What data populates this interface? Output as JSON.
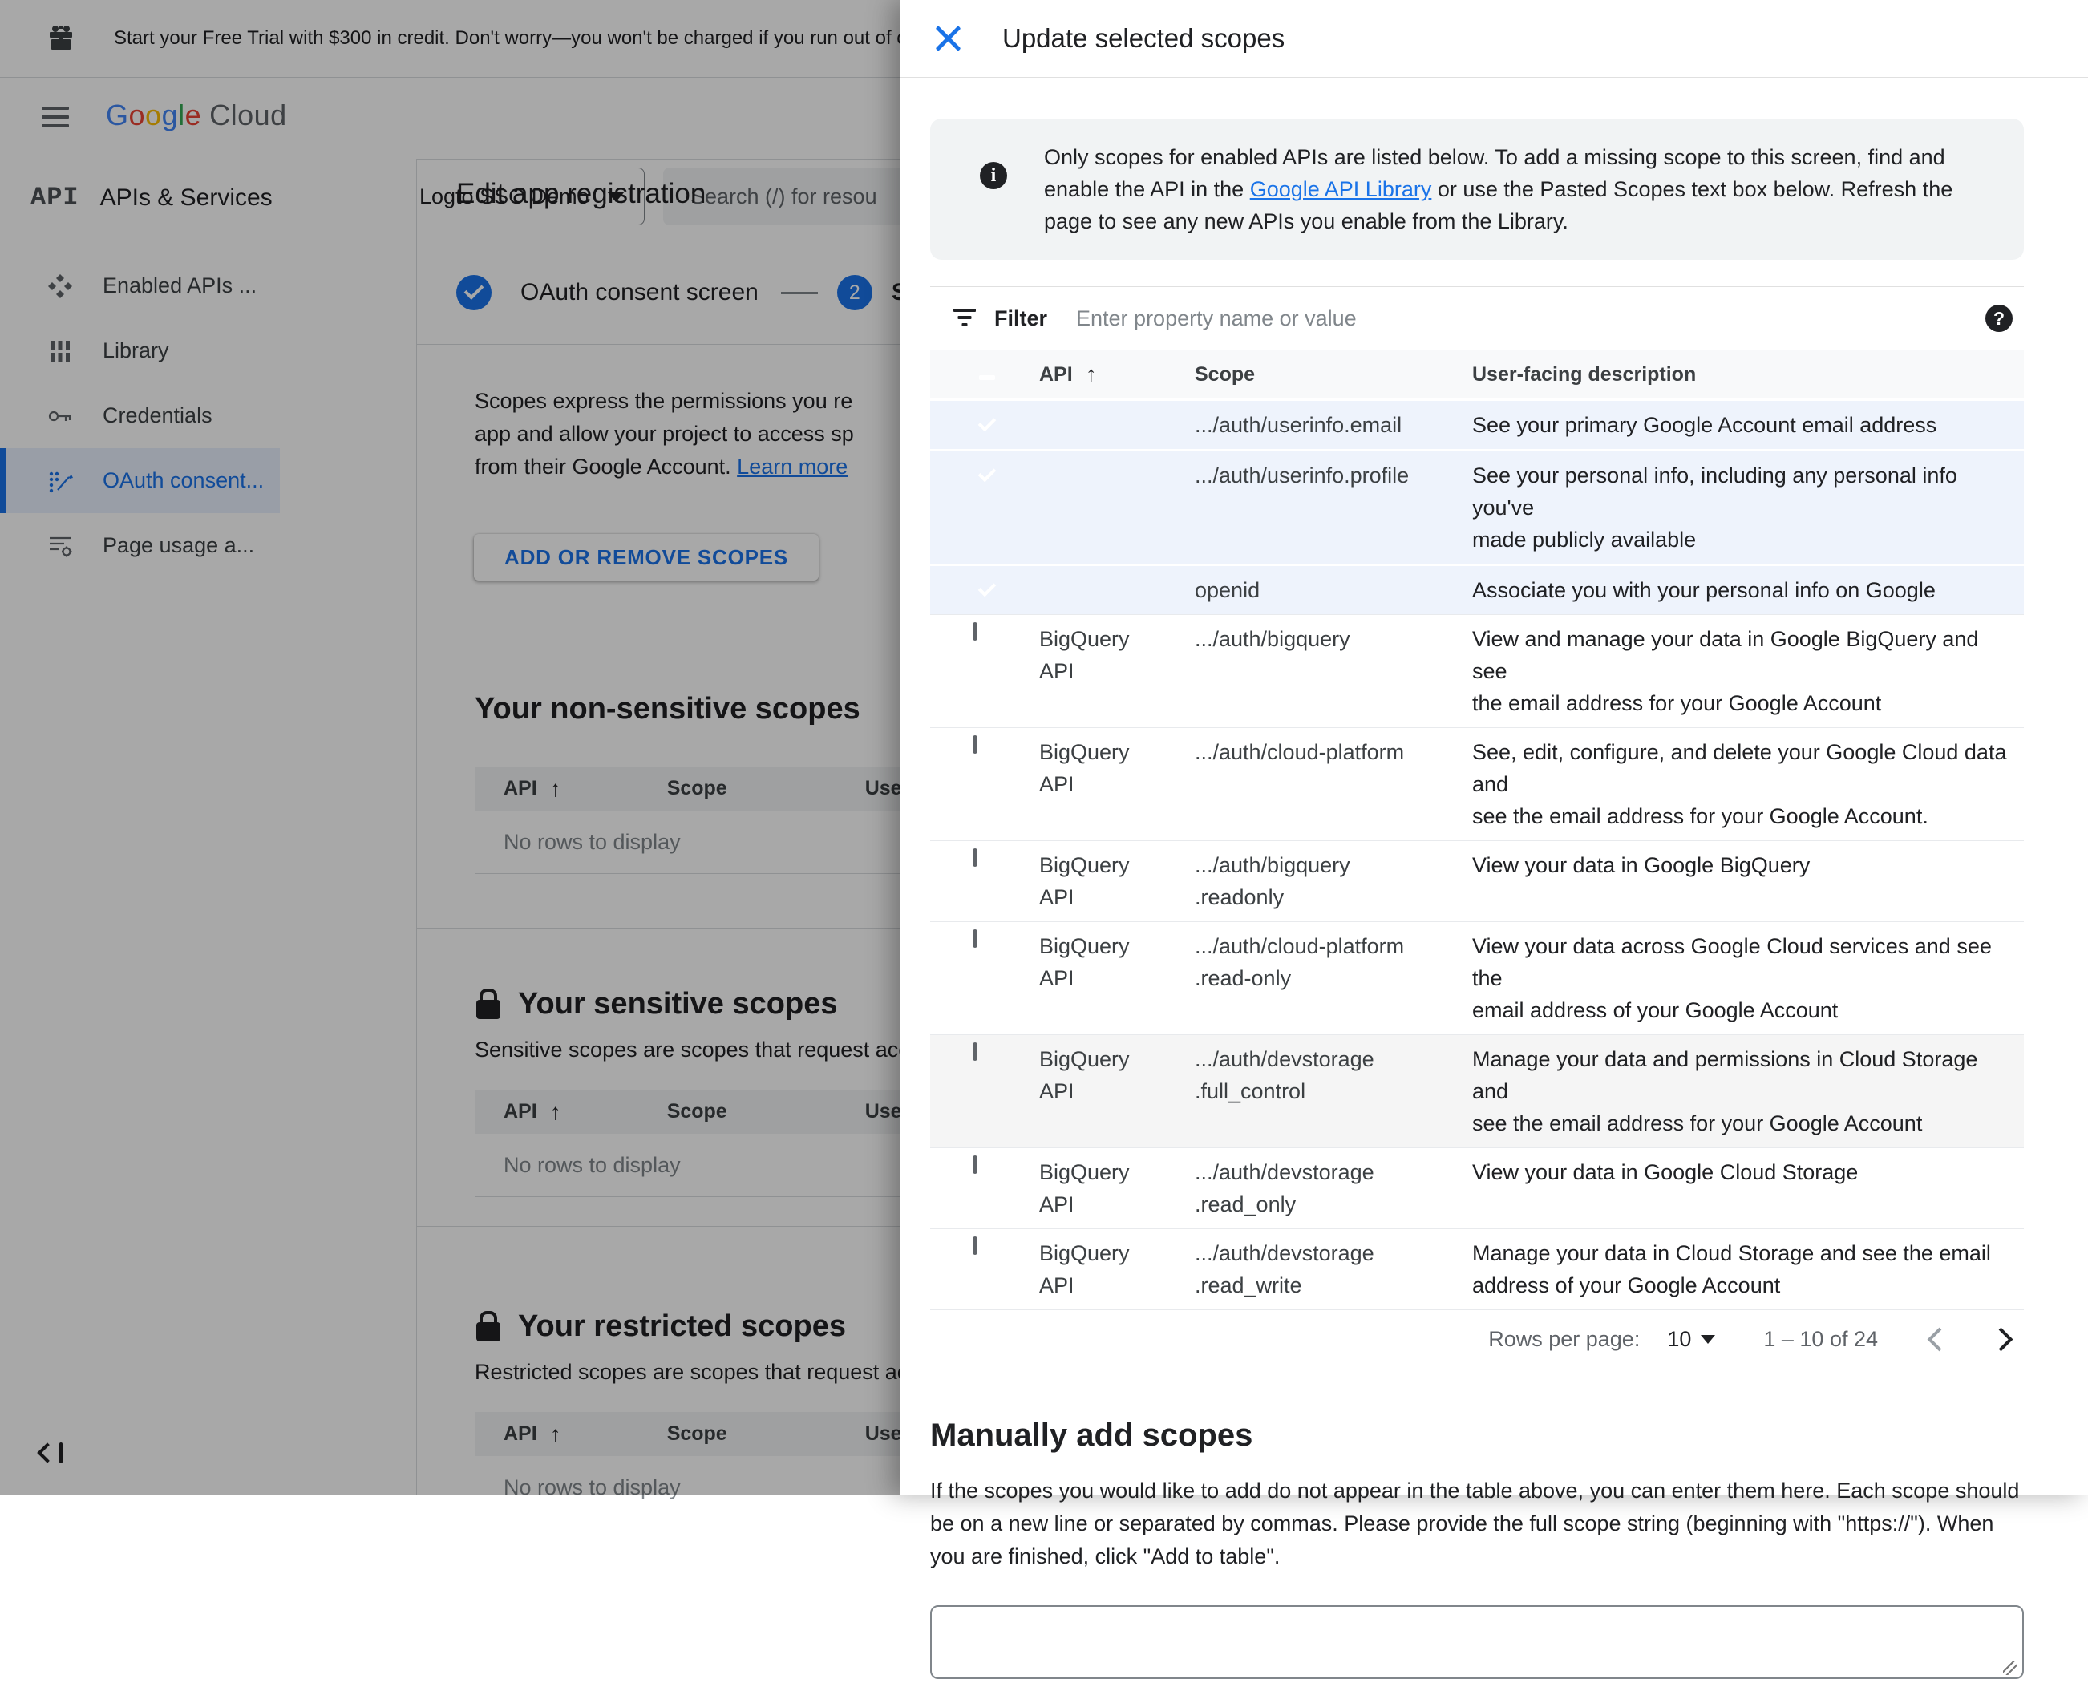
{
  "colors": {
    "accent_blue": "#1a73e8",
    "checkbox_blue": "#1967d2",
    "selected_row_bg": "#eef3fc",
    "info_box_bg": "#f1f3f4"
  },
  "banner": {
    "icon": "gift-icon",
    "text": "Start your Free Trial with $300 in credit. Don't worry—you won't be charged if you run out of c"
  },
  "header": {
    "logo_google": "Google",
    "logo_cloud": "Cloud",
    "project_selector_label": "Logto SSO Demo",
    "search_placeholder": "Search (/) for resou"
  },
  "sidebar": {
    "logo_glyph": "API",
    "title": "APIs & Services",
    "items": [
      {
        "label": "Enabled APIs ...",
        "icon": "enabled-apis",
        "selected": false
      },
      {
        "label": "Library",
        "icon": "library",
        "selected": false
      },
      {
        "label": "Credentials",
        "icon": "key",
        "selected": false
      },
      {
        "label": "OAuth consent...",
        "icon": "oauth-consent",
        "selected": true
      },
      {
        "label": "Page usage a...",
        "icon": "page-usage",
        "selected": false
      }
    ]
  },
  "main": {
    "title": "Edit app registration",
    "stepper": {
      "step1_label": "OAuth consent screen",
      "step2_number": "2",
      "step2_label": "Sco"
    },
    "intro_lines": [
      "Scopes express the permissions you re",
      "app and allow your project to access sp"
    ],
    "intro_line3_prefix": "from their Google Account. ",
    "intro_link": "Learn more",
    "add_scopes_button": "ADD OR REMOVE SCOPES",
    "sections": [
      {
        "heading": "Your non-sensitive scopes",
        "lock": false,
        "description": "",
        "columns": [
          "API",
          "Scope",
          "User-"
        ],
        "empty_text": "No rows to display"
      },
      {
        "heading": "Your sensitive scopes",
        "lock": true,
        "description": "Sensitive scopes are scopes that request acc",
        "columns": [
          "API",
          "Scope",
          "User-"
        ],
        "empty_text": "No rows to display"
      },
      {
        "heading": "Your restricted scopes",
        "lock": true,
        "description": "Restricted scopes are scopes that request ac",
        "columns": [
          "API",
          "Scope",
          "User-"
        ],
        "empty_text": "No rows to display"
      }
    ]
  },
  "panel": {
    "title": "Update selected scopes",
    "info": {
      "icon": "info-icon",
      "text_before_link": "Only scopes for enabled APIs are listed below. To add a missing scope to this screen, find and enable the API in the ",
      "link": "Google API Library",
      "text_after_link": " or use the Pasted Scopes text box below. Refresh the page to see any new APIs you enable from the Library."
    },
    "filter": {
      "label": "Filter",
      "placeholder": "Enter property name or value",
      "help_icon": "help-icon"
    },
    "table": {
      "columns": [
        "API",
        "Scope",
        "User-facing description"
      ],
      "rows": [
        {
          "checked": true,
          "state": "selected",
          "api": "",
          "scope": ".../auth/userinfo.email",
          "description": "See your primary Google Account email address"
        },
        {
          "checked": true,
          "state": "selected",
          "api": "",
          "scope": ".../auth/userinfo.profile",
          "description": "See your personal info, including any personal info you've\nmade publicly available"
        },
        {
          "checked": true,
          "state": "selected",
          "api": "",
          "scope": "openid",
          "description": "Associate you with your personal info on Google"
        },
        {
          "checked": false,
          "state": "",
          "api": "BigQuery\nAPI",
          "scope": ".../auth/bigquery",
          "description": "View and manage your data in Google BigQuery and see\nthe email address for your Google Account"
        },
        {
          "checked": false,
          "state": "",
          "api": "BigQuery\nAPI",
          "scope": ".../auth/cloud-platform",
          "description": "See, edit, configure, and delete your Google Cloud data and\nsee the email address for your Google Account."
        },
        {
          "checked": false,
          "state": "",
          "api": "BigQuery\nAPI",
          "scope": ".../auth/bigquery\n.readonly",
          "description": "View your data in Google BigQuery"
        },
        {
          "checked": false,
          "state": "",
          "api": "BigQuery\nAPI",
          "scope": ".../auth/cloud-platform\n.read-only",
          "description": "View your data across Google Cloud services and see the\nemail address of your Google Account"
        },
        {
          "checked": false,
          "state": "hover",
          "api": "BigQuery\nAPI",
          "scope": ".../auth/devstorage\n.full_control",
          "description": "Manage your data and permissions in Cloud Storage and\nsee the email address for your Google Account"
        },
        {
          "checked": false,
          "state": "",
          "api": "BigQuery\nAPI",
          "scope": ".../auth/devstorage\n.read_only",
          "description": "View your data in Google Cloud Storage"
        },
        {
          "checked": false,
          "state": "",
          "api": "BigQuery\nAPI",
          "scope": ".../auth/devstorage\n.read_write",
          "description": "Manage your data in Cloud Storage and see the email\naddress of your Google Account"
        }
      ]
    },
    "pagination": {
      "rows_per_page_label": "Rows per page:",
      "rows_per_page_value": "10",
      "range": "1 – 10 of 24"
    },
    "manual": {
      "heading": "Manually add scopes",
      "description": "If the scopes you would like to add do not appear in the table above, you can enter them here. Each scope should be on a new line or separated by commas. Please provide the full scope string (beginning with \"https://\"). When you are finished, click \"Add to table\".",
      "textarea_value": ""
    }
  }
}
